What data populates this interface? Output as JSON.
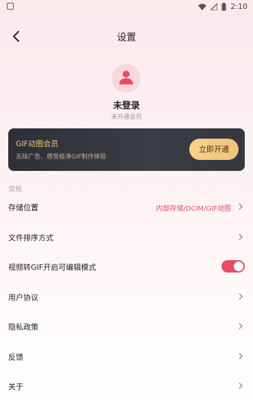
{
  "status": {
    "time": "2:10"
  },
  "header": {
    "title": "设置"
  },
  "profile": {
    "login_text": "未登录",
    "vip_status": "未开通会员"
  },
  "vip_card": {
    "title": "GIF动图会员",
    "subtitle": "去除广告、感受极净GIF制作体验",
    "button": "立即开通"
  },
  "section": {
    "title": "常规"
  },
  "rows": [
    {
      "label": "存储位置",
      "value": "内部存储/DCIM/GIF动图"
    },
    {
      "label": "文件排序方式"
    },
    {
      "label": "视频转GIF开启可编辑模式",
      "toggle_on": true
    },
    {
      "label": "用户协议"
    },
    {
      "label": "隐私政策"
    },
    {
      "label": "反馈"
    },
    {
      "label": "关于"
    }
  ],
  "colors": {
    "accent": "#e44d63",
    "gold": "#f1c27a",
    "card_bg": "#2e3038"
  }
}
